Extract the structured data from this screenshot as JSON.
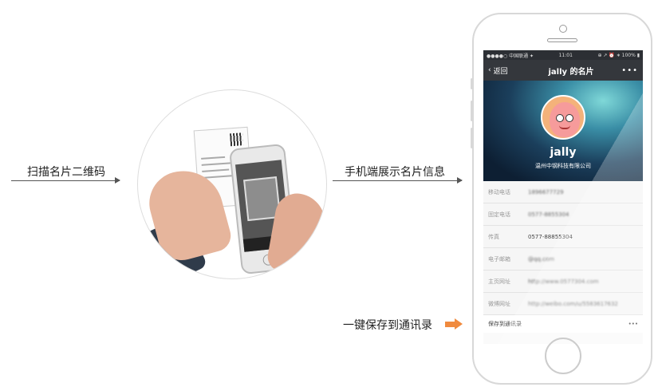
{
  "labels": {
    "scan": "扫描名片二维码",
    "display": "手机端展示名片信息",
    "save": "一键保存到通讯录"
  },
  "status": {
    "carrier": "●●●●○ 中国联通 ✦",
    "time": "11:01",
    "right": "⊕ ↗ ⏰ ∗ 100% ▮"
  },
  "nav": {
    "back": "返回",
    "title": "jally 的名片",
    "more": "•••"
  },
  "profile": {
    "name": "jally",
    "company": "温州中钢科技有限公司"
  },
  "fields": [
    {
      "label": "移动电话",
      "value": "1896677729"
    },
    {
      "label": "固定电话",
      "value": "0577-8855304"
    },
    {
      "label": "传真",
      "value": "0577-88855304"
    },
    {
      "label": "电子邮箱",
      "value": "@qq.com"
    },
    {
      "label": "主页网址",
      "value": "http://www.0577304.com"
    },
    {
      "label": "微博网址",
      "value": "http://weibo.com/u/5583617632"
    }
  ],
  "save_bar": {
    "label": "保存到通讯录",
    "more": "•••"
  },
  "colors": {
    "accent_arrow": "#f08a3e",
    "navbar": "#34373c"
  }
}
